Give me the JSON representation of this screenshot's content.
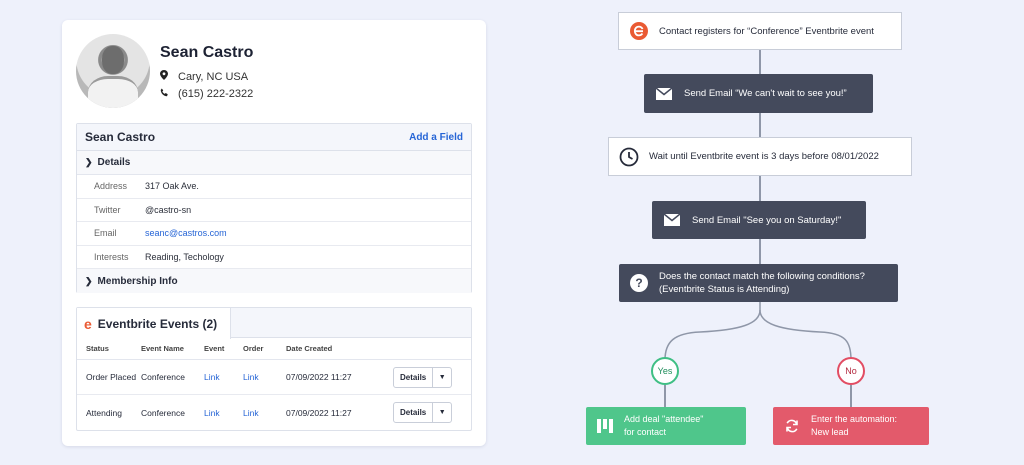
{
  "contact": {
    "name": "Sean Castro",
    "location": "Cary, NC USA",
    "phone": "(615) 222-2322"
  },
  "fields_panel": {
    "title": "Sean Castro",
    "add_field_label": "Add a Field",
    "details_label": "Details",
    "fields": [
      {
        "key": "Address",
        "value": "317 Oak Ave."
      },
      {
        "key": "Twitter",
        "value": "@castro-sn"
      },
      {
        "key": "Email",
        "value": "seanc@castros.com"
      },
      {
        "key": "Interests",
        "value": "Reading, Techology"
      }
    ],
    "membership_label": "Membership Info"
  },
  "events": {
    "tab_label": "Eventbrite Events (2)",
    "columns": [
      "Status",
      "Event Name",
      "Event",
      "Order",
      "Date Created"
    ],
    "rows": [
      {
        "status": "Order Placed",
        "event_name": "Conference",
        "event": "Link",
        "order": "Link",
        "date": "07/09/2022 11:27",
        "button": "Details"
      },
      {
        "status": "Attending",
        "event_name": "Conference",
        "event": "Link",
        "order": "Link",
        "date": "07/09/2022 11:27",
        "button": "Details"
      }
    ]
  },
  "flow": {
    "trigger": "Contact registers for “Conference” Eventbrite event",
    "step1": "Send Email “We can't wait to see you!”",
    "wait": "Wait until Eventbrite event is 3 days before 08/01/2022",
    "step2": "Send Email \"See you on Saturday!\"",
    "condition_line1": "Does the contact match the following conditions?",
    "condition_line2": "(Eventbrite Status is Attending)",
    "yes": "Yes",
    "no": "No",
    "yes_action_line1": "Add deal \"attendee\"",
    "yes_action_line2": "for contact",
    "no_action_line1": "Enter the automation:",
    "no_action_line2": "New lead"
  },
  "colors": {
    "brand_eventbrite": "#ea5a33",
    "link": "#2665d6",
    "yes": "#4fc68b",
    "no": "#e35a6b",
    "dark_step": "#444a5c"
  }
}
